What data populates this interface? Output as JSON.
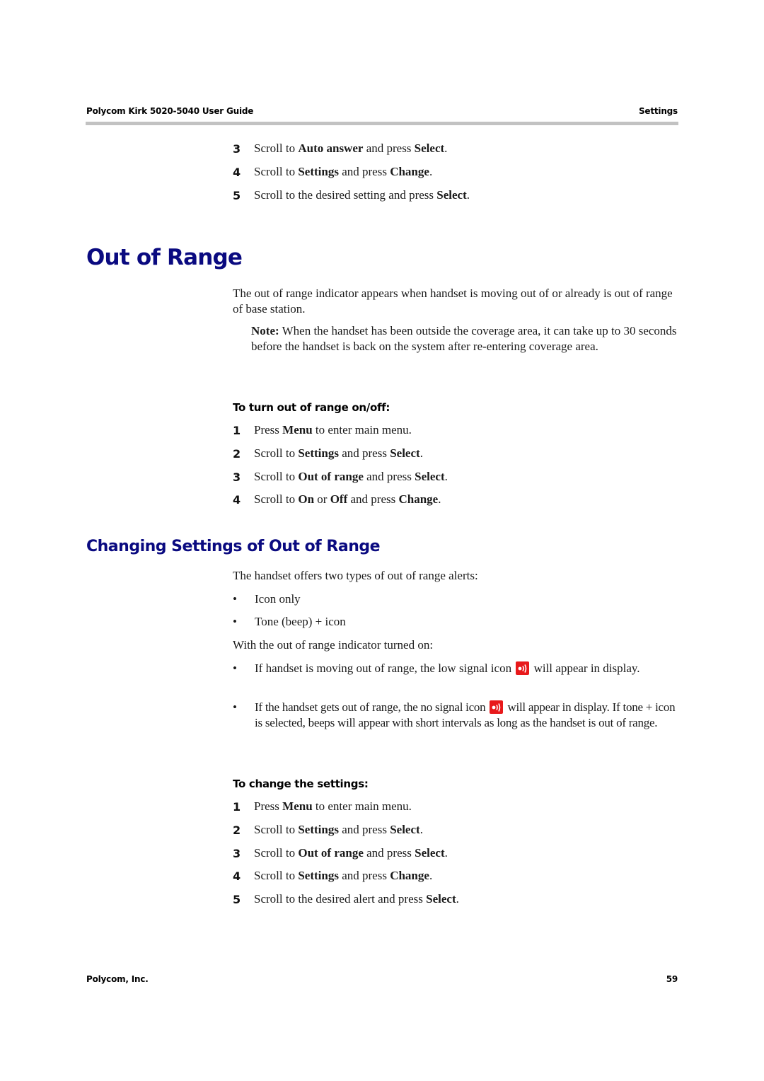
{
  "header": {
    "left": "Polycom Kirk 5020-5040 User Guide",
    "right": "Settings"
  },
  "footer": {
    "left": "Polycom, Inc.",
    "page_number": "59"
  },
  "intro_steps": [
    {
      "num": "3",
      "pre": "Scroll to ",
      "b1": "Auto answer",
      "mid": " and press ",
      "b2": "Select",
      "post": "."
    },
    {
      "num": "4",
      "pre": "Scroll to ",
      "b1": "Settings",
      "mid": " and press ",
      "b2": "Change",
      "post": "."
    },
    {
      "num": "5",
      "pre": "Scroll to the desired setting and press ",
      "b1": "Select",
      "mid": ".",
      "b2": "",
      "post": ""
    }
  ],
  "section1": {
    "title": "Out of Range",
    "intro": "The out of range indicator appears when handset is moving out of or already is out of range of base station.",
    "note_label": "Note:",
    "note_text": " When the handset has been outside the coverage area, it can take up to 30 seconds before the handset is back on the system after re-entering coverage area.",
    "procedure_title": "To turn out of range on/off:",
    "steps": [
      {
        "num": "1",
        "pre": "Press ",
        "b1": "Menu",
        "mid": " to enter main menu.",
        "b2": "",
        "post": ""
      },
      {
        "num": "2",
        "pre": "Scroll to ",
        "b1": "Settings",
        "mid": " and press ",
        "b2": "Select",
        "post": "."
      },
      {
        "num": "3",
        "pre": "Scroll to ",
        "b1": "Out of range",
        "mid": " and press ",
        "b2": "Select",
        "post": "."
      },
      {
        "num": "4",
        "pre": "Scroll to ",
        "b1": "On",
        "mid": " or ",
        "b2": "Off",
        "post": " and press ",
        "b3": "Change",
        "post2": "."
      }
    ]
  },
  "section2": {
    "title": "Changing Settings of Out of Range",
    "intro": "The handset offers two types of out of range alerts:",
    "alert_types": [
      "Icon only",
      "Tone (beep) + icon"
    ],
    "indicator_intro": "With the out of range indicator turned on:",
    "bullet1_pre": "If handset is moving out of range, the low signal icon",
    "bullet1_post": "will appear in display.",
    "bullet2_pre": "If the handset gets out of range, the no signal icon",
    "bullet2_post": "will appear in display. If tone + icon is selected, beeps will appear with short intervals as long as the handset is out of range.",
    "icon_color": "#e8191b",
    "procedure_title": "To change the settings:",
    "steps": [
      {
        "num": "1",
        "pre": "Press ",
        "b1": "Menu",
        "mid": " to enter main menu.",
        "b2": "",
        "post": ""
      },
      {
        "num": "2",
        "pre": "Scroll to ",
        "b1": "Settings",
        "mid": " and press ",
        "b2": "Select",
        "post": "."
      },
      {
        "num": "3",
        "pre": "Scroll to ",
        "b1": "Out of range",
        "mid": " and press ",
        "b2": "Select",
        "post": "."
      },
      {
        "num": "4",
        "pre": "Scroll to ",
        "b1": "Settings",
        "mid": " and press ",
        "b2": "Change",
        "post": "."
      },
      {
        "num": "5",
        "pre": "Scroll to the desired alert and press ",
        "b1": "Select",
        "mid": ".",
        "b2": "",
        "post": ""
      }
    ]
  }
}
